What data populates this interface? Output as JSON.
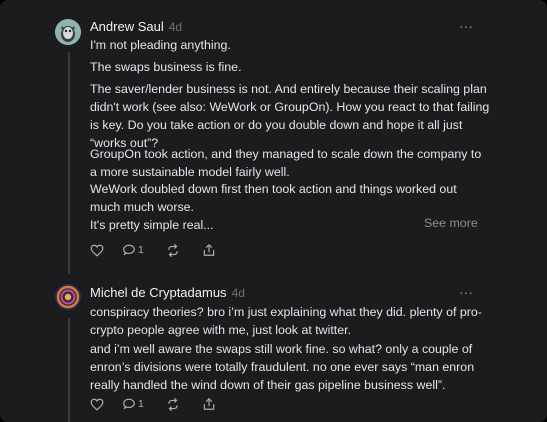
{
  "comments": [
    {
      "author": "Andrew Saul",
      "time": "4d",
      "more_label": "···",
      "paragraphs": [
        "I'm not pleading anything.",
        "The swaps business is fine.",
        "The saver/lender business is not. And entirely because their scaling plan didn't work (see also: WeWork or GroupOn). How you react to that failing is key. Do you take action or do you double down and hope it all just “works out”?",
        "GroupOn took action,  and they managed to scale down the company to a more sustainable model fairly well.",
        "WeWork doubled down first then took action and things worked out much much worse.",
        "It's pretty simple real..."
      ],
      "see_more": "See more",
      "reply_count": "1"
    },
    {
      "author": "Michel de Cryptadamus",
      "time": "4d",
      "more_label": "···",
      "paragraphs": [
        "conspiracy theories? bro i’m just explaining what they did. plenty of pro-crypto people agree with me, just look at twitter.",
        "and i’m well aware the swaps still work fine. so what? only a couple of enron’s divisions were totally fraudulent. no one ever says “man enron really handled the wind down of their gas pipeline business well”."
      ],
      "reply_count": "1"
    }
  ],
  "colors": {
    "background": "#1c1c1e",
    "text": "#e5e5ea",
    "muted": "#8e8e93"
  },
  "icons": [
    "heart-icon",
    "reply-icon",
    "repost-icon",
    "share-icon",
    "more-icon"
  ]
}
